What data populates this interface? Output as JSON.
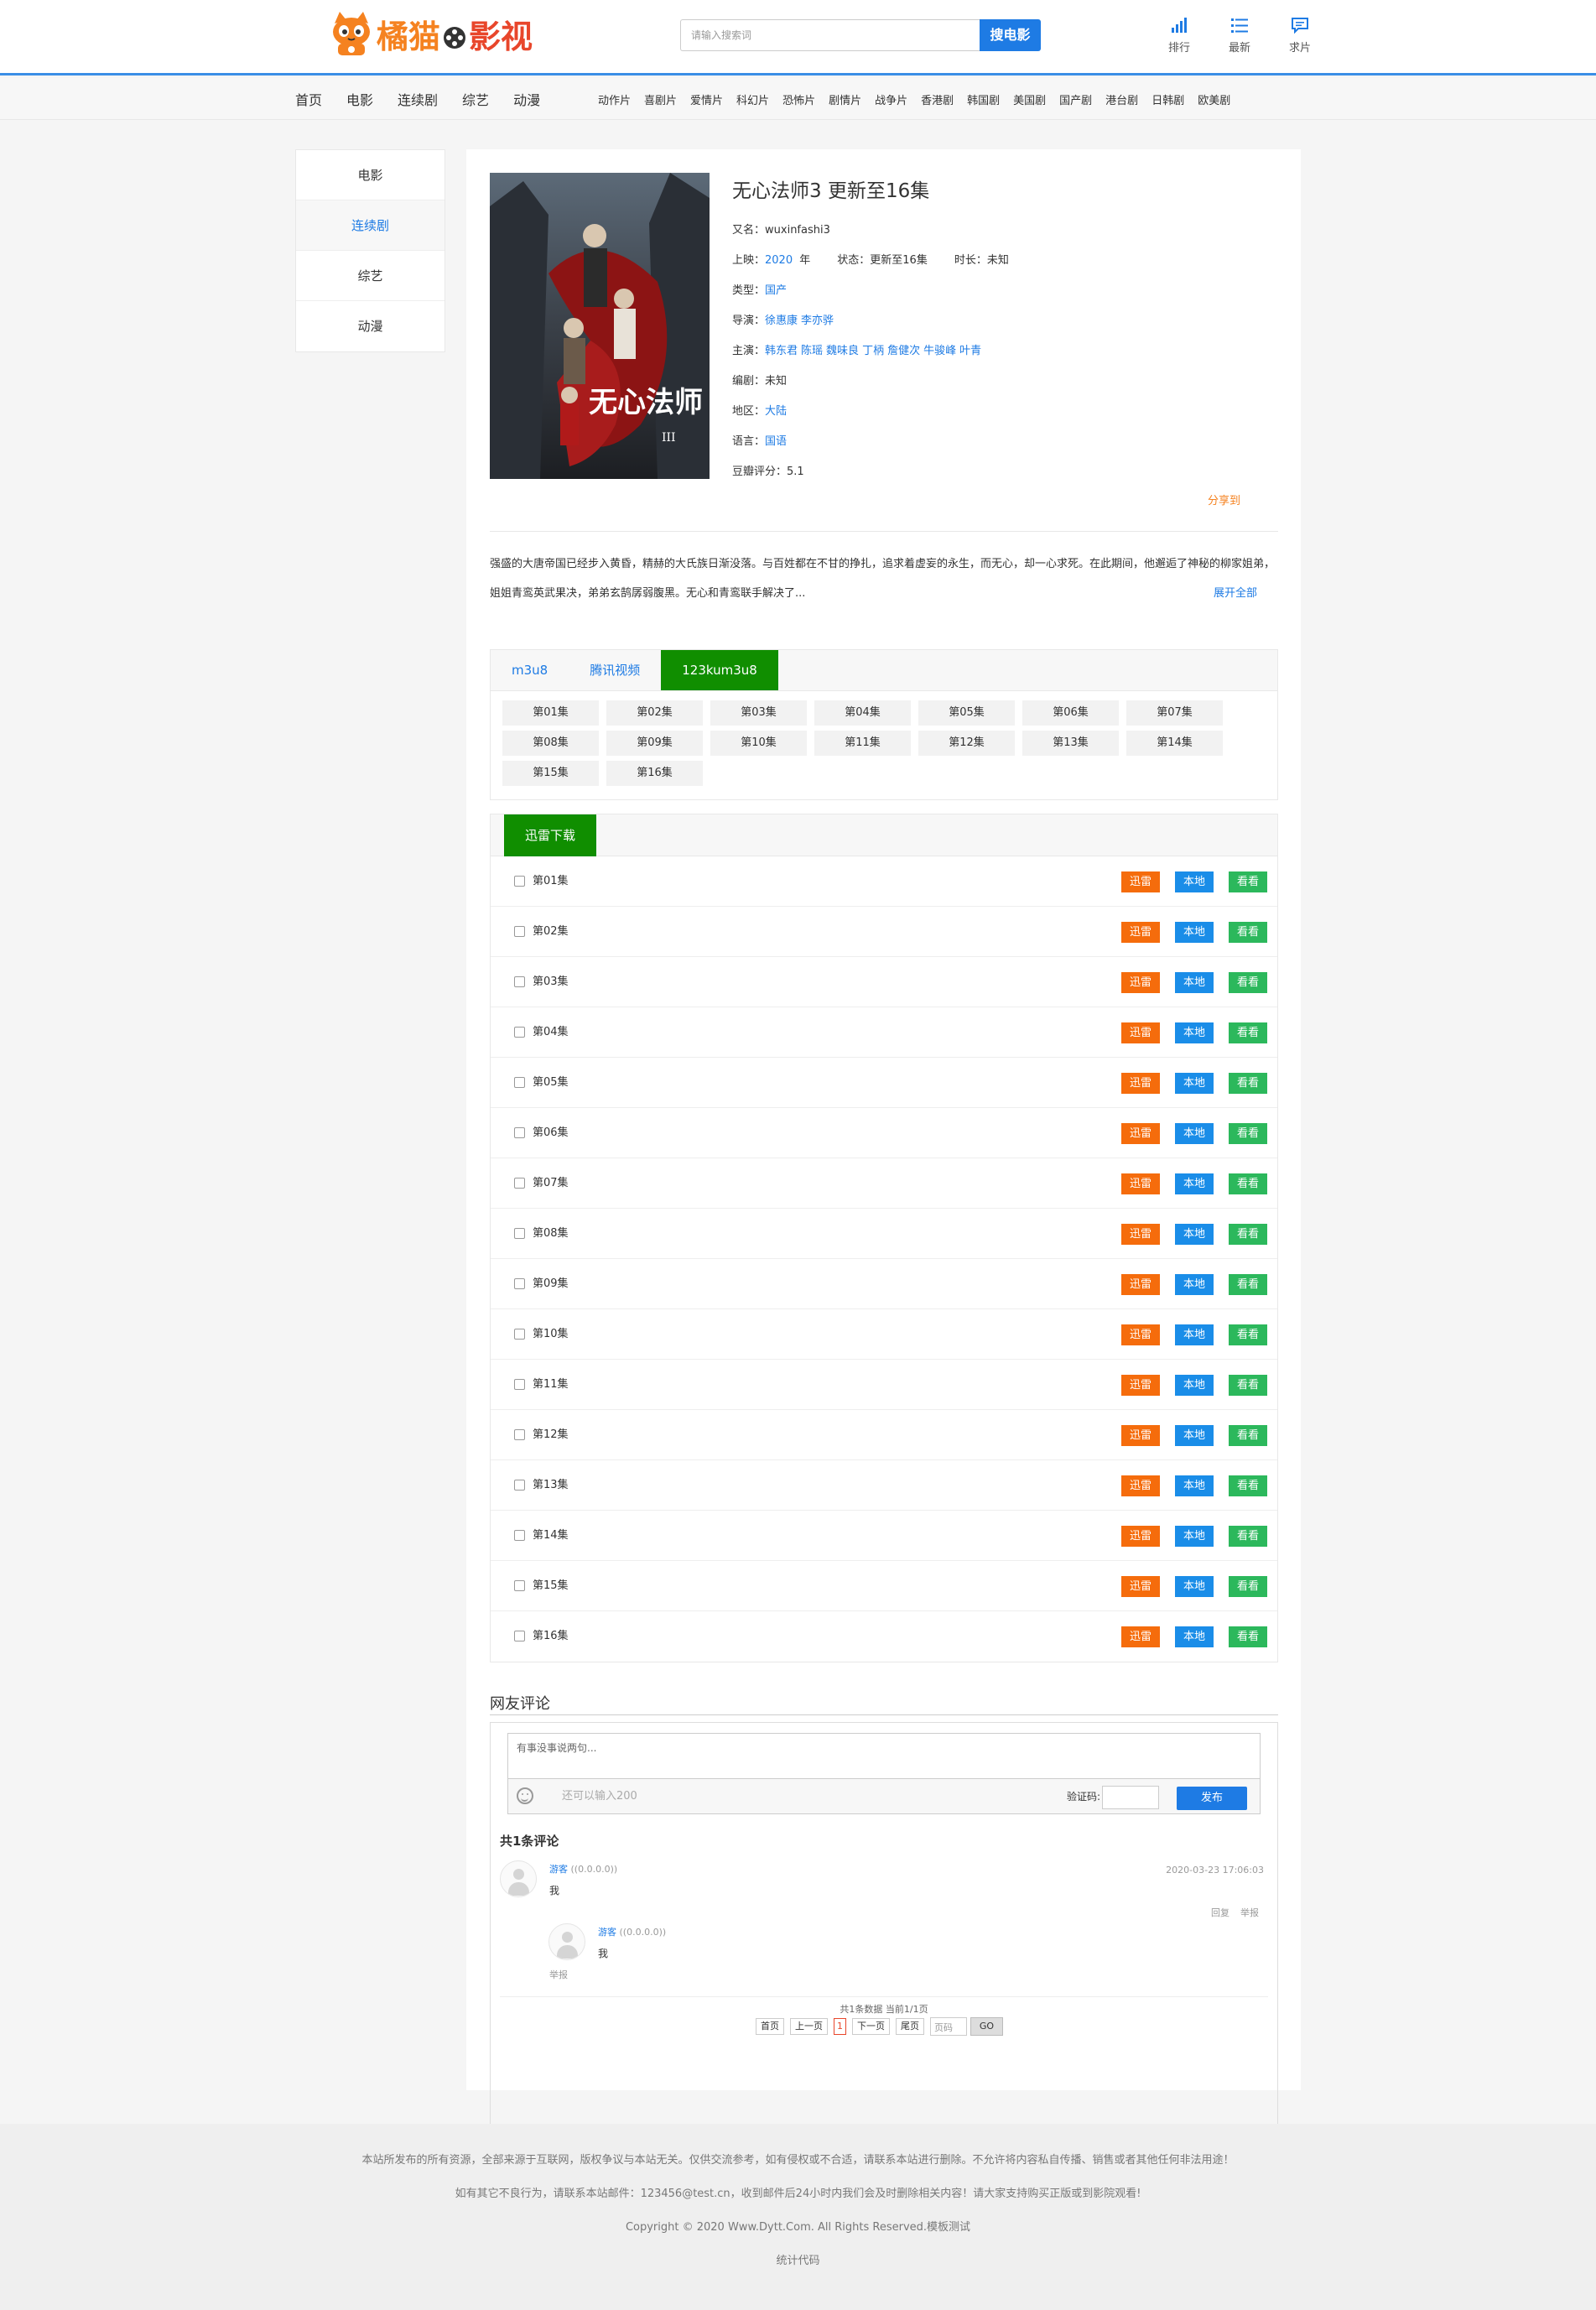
{
  "header": {
    "logo_text_1": "橘猫",
    "logo_text_2": "影视",
    "search_placeholder": "请输入搜索词",
    "search_button": "搜电影",
    "links": [
      {
        "label": "排行",
        "icon": "chart-bars-icon"
      },
      {
        "label": "最新",
        "icon": "list-icon"
      },
      {
        "label": "求片",
        "icon": "chat-bubble-icon"
      }
    ]
  },
  "nav": {
    "main": [
      "首页",
      "电影",
      "连续剧",
      "综艺",
      "动漫"
    ],
    "sub": [
      "动作片",
      "喜剧片",
      "爱情片",
      "科幻片",
      "恐怖片",
      "剧情片",
      "战争片",
      "香港剧",
      "韩国剧",
      "美国剧",
      "国产剧",
      "港台剧",
      "日韩剧",
      "欧美剧"
    ]
  },
  "sidebar": {
    "items": [
      "电影",
      "连续剧",
      "综艺",
      "动漫"
    ],
    "active_index": 1
  },
  "detail": {
    "title": "无心法师3 更新至16集",
    "alias_label": "又名：",
    "alias": "wuxinfashi3",
    "year_label": "上映：",
    "year": "2020",
    "year_suffix": "年",
    "status_label": "状态：",
    "status": "更新至16集",
    "duration_label": "时长：",
    "duration": "未知",
    "genre_label": "类型：",
    "genre": "国产",
    "director_label": "导演：",
    "directors": [
      "徐惠康",
      "李亦骅"
    ],
    "cast_label": "主演：",
    "cast": [
      "韩东君",
      "陈瑶",
      "魏味良",
      "丁柄",
      "詹健次",
      "牛骏峰",
      "叶青"
    ],
    "writer_label": "编剧：",
    "writer": "未知",
    "region_label": "地区：",
    "region": "大陆",
    "language_label": "语言：",
    "language": "国语",
    "rating_label": "豆瓣评分：",
    "rating": "5.1",
    "share": "分享到",
    "poster_title": "无心法师",
    "poster_numeral": "III"
  },
  "description": {
    "text": "强盛的大唐帝国已经步入黄昏，精赫的大氏族日渐没落。与百姓都在不甘的挣扎，追求着虚妄的永生，而无心，却一心求死。在此期间，他邂逅了神秘的柳家姐弟，姐姐青鸾英武果决，弟弟玄鹄孱弱腹黑。无心和青鸾联手解决了...",
    "more": "展开全部"
  },
  "play": {
    "tabs": [
      "m3u8",
      "腾讯视频",
      "123kum3u8"
    ],
    "active_tab": 2,
    "episodes": [
      "第01集",
      "第02集",
      "第03集",
      "第04集",
      "第05集",
      "第06集",
      "第07集",
      "第08集",
      "第09集",
      "第10集",
      "第11集",
      "第12集",
      "第13集",
      "第14集",
      "第15集",
      "第16集"
    ]
  },
  "download": {
    "tab": "迅雷下载",
    "buttons": {
      "thunder": "迅雷",
      "local": "本地",
      "watch": "看看"
    },
    "colors": {
      "thunder": "#f56c0c",
      "local": "#1a8de8",
      "watch": "#2cb85c"
    },
    "items": [
      "第01集",
      "第02集",
      "第03集",
      "第04集",
      "第05集",
      "第06集",
      "第07集",
      "第08集",
      "第09集",
      "第10集",
      "第11集",
      "第12集",
      "第13集",
      "第14集",
      "第15集",
      "第16集"
    ]
  },
  "comments": {
    "title": "网友评论",
    "placeholder": "有事没事说两句...",
    "remain": "还可以输入200",
    "captcha_label": "验证码:",
    "submit": "发布",
    "count": "共1条评论",
    "list": [
      {
        "user": "游客",
        "ip": "((0.0.0.0))",
        "text": "我",
        "time": "2020-03-23 17:06:03",
        "reply": "回复",
        "report": "举报",
        "children": [
          {
            "user": "游客",
            "ip": "((0.0.0.0))",
            "text": "我",
            "report": "举报"
          }
        ]
      }
    ],
    "pager_info": "共1条数据 当前1/1页",
    "pager": {
      "first": "首页",
      "prev": "上一页",
      "current": "1",
      "next": "下一页",
      "last": "尾页",
      "input_placeholder": "页码",
      "go": "GO"
    }
  },
  "footer": {
    "line1": "本站所发布的所有资源，全部来源于互联网，版权争议与本站无关。仅供交流参考，如有侵权或不合适，请联系本站进行删除。不允许将内容私自传播、销售或者其他任何非法用途！",
    "line2": "如有其它不良行为，请联系本站邮件：123456@test.cn，收到邮件后24小时内我们会及时删除相关内容！请大家支持购买正版或到影院观看!",
    "line3": "Copyright © 2020 Www.Dytt.Com. All Rights Reserved.模板测试",
    "line4": "统计代码"
  },
  "colors": {
    "accent_blue": "#1e7be4",
    "green_tab": "#108e00",
    "logo_orange": "#f58220",
    "header_border": "#3a8ee6"
  }
}
